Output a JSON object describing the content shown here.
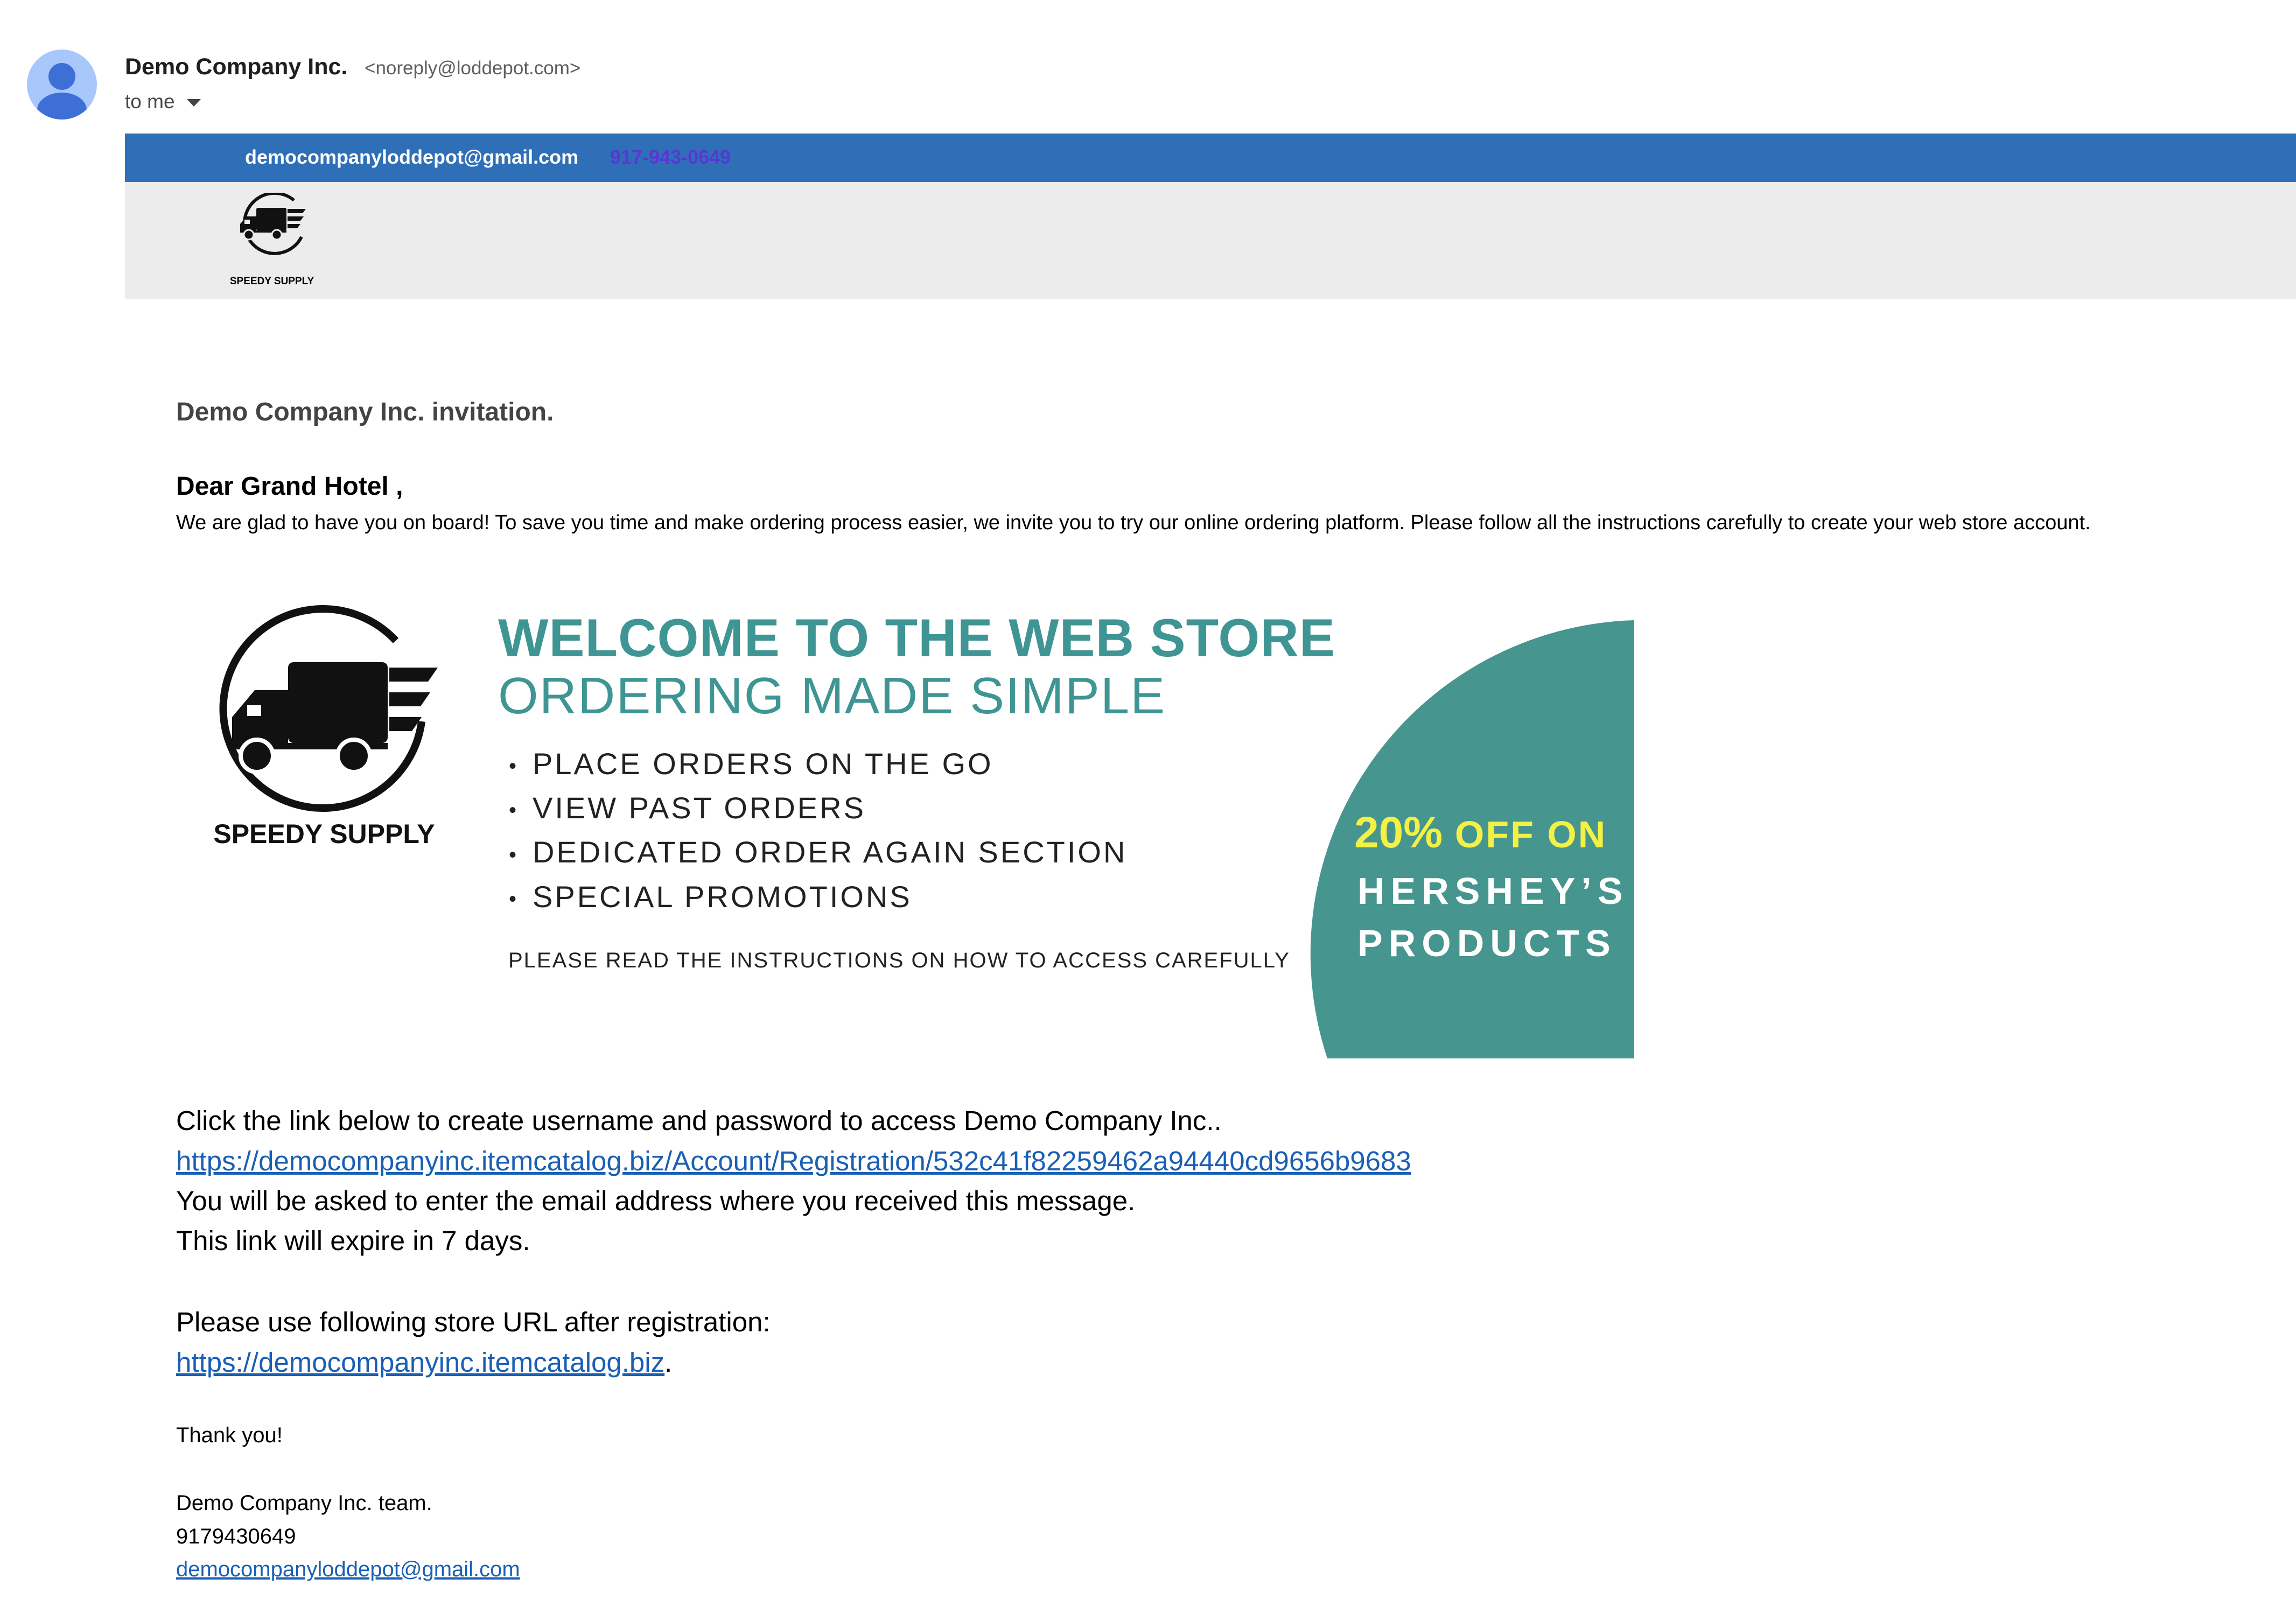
{
  "sender": {
    "name": "Demo Company Inc.",
    "email": "<noreply@loddepot.com>",
    "recipient_label": "to me"
  },
  "header_bar": {
    "email": "democompanyloddepot@gmail.com",
    "phone": "917-943-0649"
  },
  "logo": {
    "text": "SPEEDY SUPPLY"
  },
  "body": {
    "title": "Demo Company Inc. invitation.",
    "greeting": "Dear Grand Hotel ,",
    "intro": "We are glad to have you on board! To save you time and make ordering process easier, we invite you to try our online ordering platform. Please follow all the instructions carefully to create your web store account."
  },
  "banner": {
    "logo_text": "SPEEDY SUPPLY",
    "headline": "WELCOME TO THE WEB STORE",
    "subheadline": "ORDERING MADE SIMPLE",
    "features": [
      "PLACE ORDERS ON THE GO",
      "VIEW PAST ORDERS",
      "DEDICATED ORDER AGAIN SECTION",
      "SPECIAL PROMOTIONS"
    ],
    "note": "PLEASE READ THE INSTRUCTIONS ON HOW TO ACCESS CAREFULLY",
    "promo": {
      "percent": "20%",
      "line1_rest": "OFF ON",
      "line2": "HERSHEY’S",
      "line3": "PRODUCTS"
    },
    "colors": {
      "teal": "#3f9593",
      "promo_yellow": "#f3f046"
    }
  },
  "instructions": {
    "click_text": "Click the link below to create username and password to access Demo Company Inc..",
    "registration_link": "https://democompanyinc.itemcatalog.biz/Account/Registration/532c41f82259462a94440cd9656b9683",
    "email_note": "You will be asked to enter the email address where you received this message.",
    "expire_note": "This link will expire in 7 days.",
    "store_note": "Please use following store URL after registration:",
    "store_link": "https://democompanyinc.itemcatalog.biz",
    "store_link_suffix": "."
  },
  "signature": {
    "thanks": "Thank you!",
    "team": "Demo Company Inc. team.",
    "phone": "9179430649",
    "email": "democompanyloddepot@gmail.com"
  },
  "colors": {
    "bar_blue": "#2e6fb7",
    "strip_gray": "#ececec",
    "link_blue": "#1a5fb4"
  },
  "icons": {
    "avatar": "person-icon",
    "caret": "caret-down-icon",
    "logo": "delivery-truck-icon"
  }
}
